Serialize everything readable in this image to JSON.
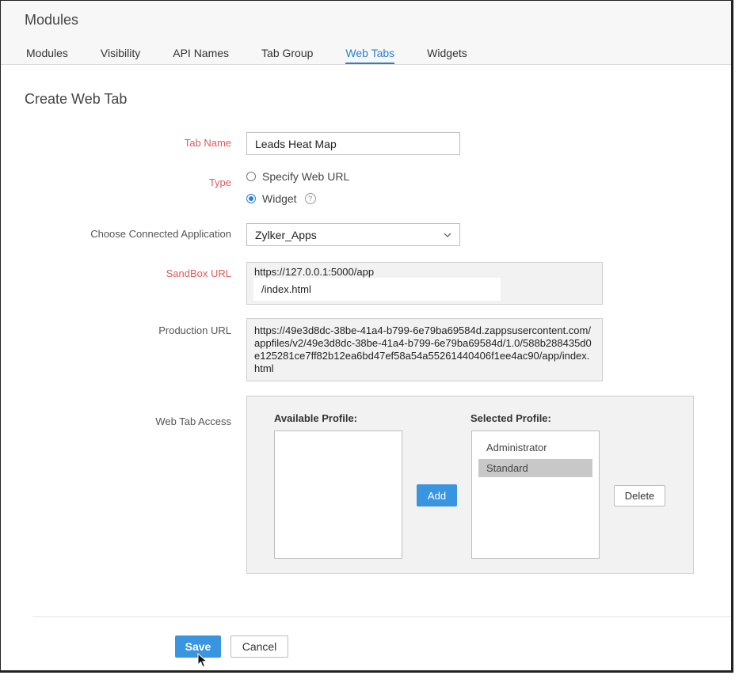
{
  "header": {
    "title": "Modules"
  },
  "tabs": [
    {
      "label": "Modules",
      "active": false
    },
    {
      "label": "Visibility",
      "active": false
    },
    {
      "label": "API Names",
      "active": false
    },
    {
      "label": "Tab Group",
      "active": false
    },
    {
      "label": "Web Tabs",
      "active": true
    },
    {
      "label": "Widgets",
      "active": false
    }
  ],
  "page": {
    "title": "Create Web Tab"
  },
  "form": {
    "tab_name": {
      "label": "Tab Name",
      "value": "Leads Heat Map"
    },
    "type": {
      "label": "Type",
      "options": [
        {
          "label": "Specify Web URL",
          "selected": false
        },
        {
          "label": "Widget",
          "selected": true
        }
      ],
      "help": "?"
    },
    "connected_app": {
      "label": "Choose Connected Application",
      "value": "Zylker_Apps"
    },
    "sandbox_url": {
      "label": "SandBox URL",
      "prefix": "https://127.0.0.1:5000/app",
      "value": "/index.html"
    },
    "production_url": {
      "label": "Production URL",
      "value": "https://49e3d8dc-38be-41a4-b799-6e79ba69584d.zappsusercontent.com/appfiles/v2/49e3d8dc-38be-41a4-b799-6e79ba69584d/1.0/588b288435d0e125281ce7ff82b12ea6bd47ef58a54a55261440406f1ee4ac90/app/index.html"
    },
    "web_tab_access": {
      "label": "Web Tab Access",
      "available_label": "Available Profile:",
      "selected_label": "Selected Profile:",
      "available": [],
      "selected": [
        "Administrator",
        "Standard"
      ],
      "add_label": "Add",
      "delete_label": "Delete"
    }
  },
  "footer": {
    "save_label": "Save",
    "cancel_label": "Cancel"
  },
  "colors": {
    "accent": "#2b7fd1",
    "required": "#e05a5a",
    "primary_button": "#3a95e0"
  }
}
